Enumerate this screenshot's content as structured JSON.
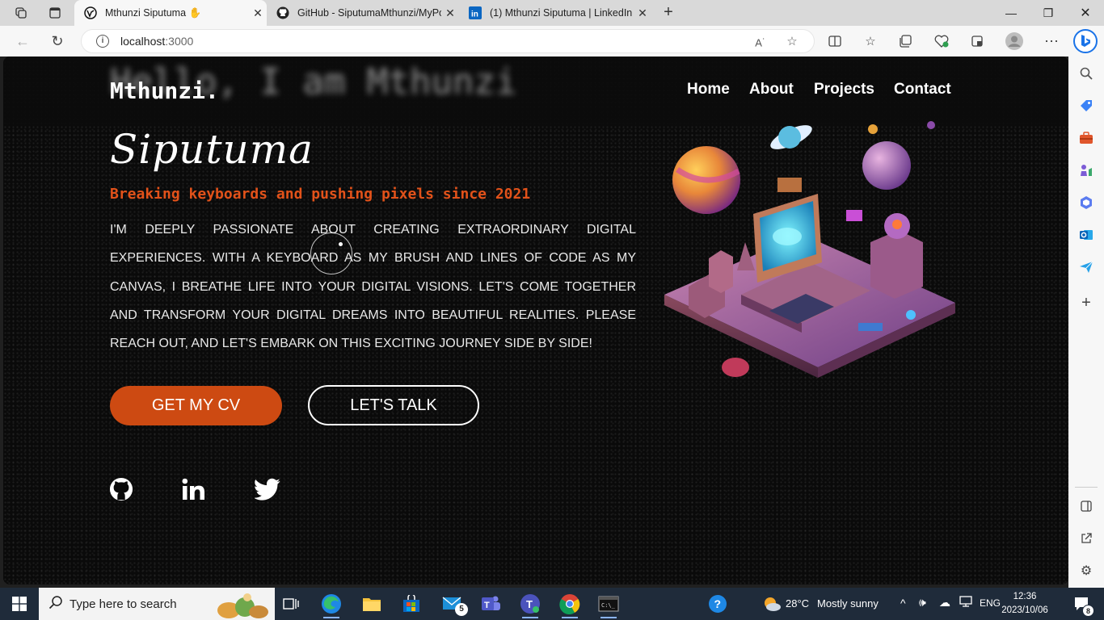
{
  "browser": {
    "tabs": [
      {
        "title": "Mthunzi Siputuma ✋",
        "active": true,
        "favicon": "site-logo-icon"
      },
      {
        "title": "GitHub - SiputumaMthunzi/MyPo",
        "active": false,
        "favicon": "github-icon"
      },
      {
        "title": "(1) Mthunzi Siputuma | LinkedIn",
        "active": false,
        "favicon": "linkedin-icon"
      }
    ],
    "address": {
      "host": "localhost",
      "port": ":3000"
    }
  },
  "site": {
    "ghost_heading": "Hello, I am Mthunzi",
    "logo": "Mthunzi.",
    "nav": [
      "Home",
      "About",
      "Projects",
      "Contact"
    ],
    "hero_name": "Siputuma",
    "tagline": "Breaking keyboards and pushing pixels since 2021",
    "about": "I'm deeply passionate about creating extraordinary digital experiences. With a keyboard as my brush and lines of code as my canvas, I breathe life into your digital visions. Let's come together and transform your digital dreams into beautiful realities. Please reach out, and let's embark on this exciting journey side by side!",
    "buttons": {
      "cv": "GET MY CV",
      "talk": "LET'S TALK"
    },
    "social": [
      "github-icon",
      "linkedin-icon",
      "twitter-icon"
    ],
    "accent": "#cd4a12"
  },
  "taskbar": {
    "search_placeholder": "Type here to search",
    "mail_badge": "5",
    "weather": {
      "temp": "28°C",
      "condition": "Mostly sunny"
    },
    "language": "ENG",
    "time": "12:36",
    "date": "2023/10/06",
    "notifications": "8"
  }
}
